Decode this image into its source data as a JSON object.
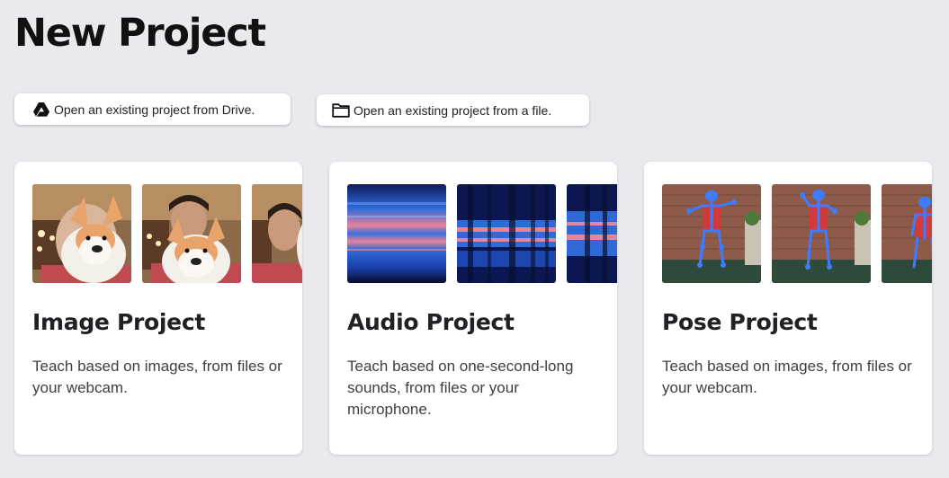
{
  "header": {
    "title": "New Project"
  },
  "open_buttons": {
    "drive": {
      "label": "Open an existing project from Drive.",
      "icon": "google-drive-icon"
    },
    "file": {
      "label": "Open an existing project from a file.",
      "icon": "folder-icon"
    }
  },
  "cards": [
    {
      "title": "Image Project",
      "description": "Teach based on images, from files or your webcam.",
      "thumbnails": [
        "person-with-plush-dog-photo",
        "person-with-plush-dog-photo",
        "person-with-plush-dog-photo"
      ]
    },
    {
      "title": "Audio Project",
      "description": "Teach based on one-second-long sounds, from files or your microphone.",
      "thumbnails": [
        "spectrogram-image",
        "spectrogram-image",
        "spectrogram-image"
      ]
    },
    {
      "title": "Pose Project",
      "description": "Teach based on images, from files or your webcam.",
      "thumbnails": [
        "pose-skeleton-photo",
        "pose-skeleton-photo",
        "pose-skeleton-photo"
      ]
    }
  ],
  "colors": {
    "background": "#e9eaee",
    "card": "#ffffff",
    "title_text": "#202124",
    "pose_skeleton": "#3d7bff",
    "spectrogram_pink": "#e7839a",
    "spectrogram_blue": "#2f6bd8"
  }
}
